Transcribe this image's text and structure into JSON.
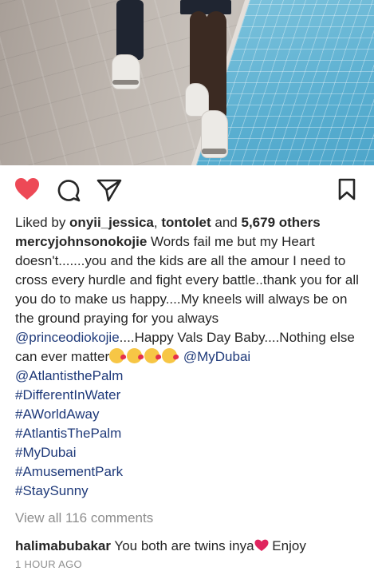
{
  "post": {
    "likes": {
      "prefix": "Liked by ",
      "user1": "onyii_jessica",
      "sep": ", ",
      "user2": "tontolet",
      "and": " and ",
      "count": "5,679 others"
    },
    "caption": {
      "username": "mercyjohnsonokojie",
      "text1": " Words fail me but my Heart doesn't.......you and the kids are all the amour I need to cross every hurdle and fight every battle..thank you for all you do to make us happy....My kneels will always be on the ground praying for you always ",
      "mention1": "@princeodiokojie",
      "text2": "....Happy Vals Day Baby....Nothing else can ever matter",
      "emojis": [
        "smiling-hearts-emoji",
        "kissing-heart-emoji",
        "kissing-heart-emoji",
        "kissing-heart-emoji"
      ],
      "mention2": "@MyDubai",
      "tags": [
        "@AtlantisthePalm",
        "#DifferentInWater",
        "#AWorldAway",
        "#AtlantisThePalm",
        "#MyDubai",
        "#AmusementPark",
        "#StaySunny"
      ]
    },
    "view_all": "View all 116 comments",
    "comment": {
      "username": "halimabubakar",
      "text": " You both are twins inya",
      "text_after": " Enjoy"
    },
    "timestamp": "1 HOUR AGO"
  },
  "actions": {
    "like_icon": "heart-icon",
    "comment_icon": "comment-icon",
    "share_icon": "share-icon",
    "save_icon": "bookmark-icon",
    "like_color": "#ed4956"
  },
  "colors": {
    "link": "#1f3a7a",
    "muted": "#8e8e8e",
    "text": "#262626"
  }
}
